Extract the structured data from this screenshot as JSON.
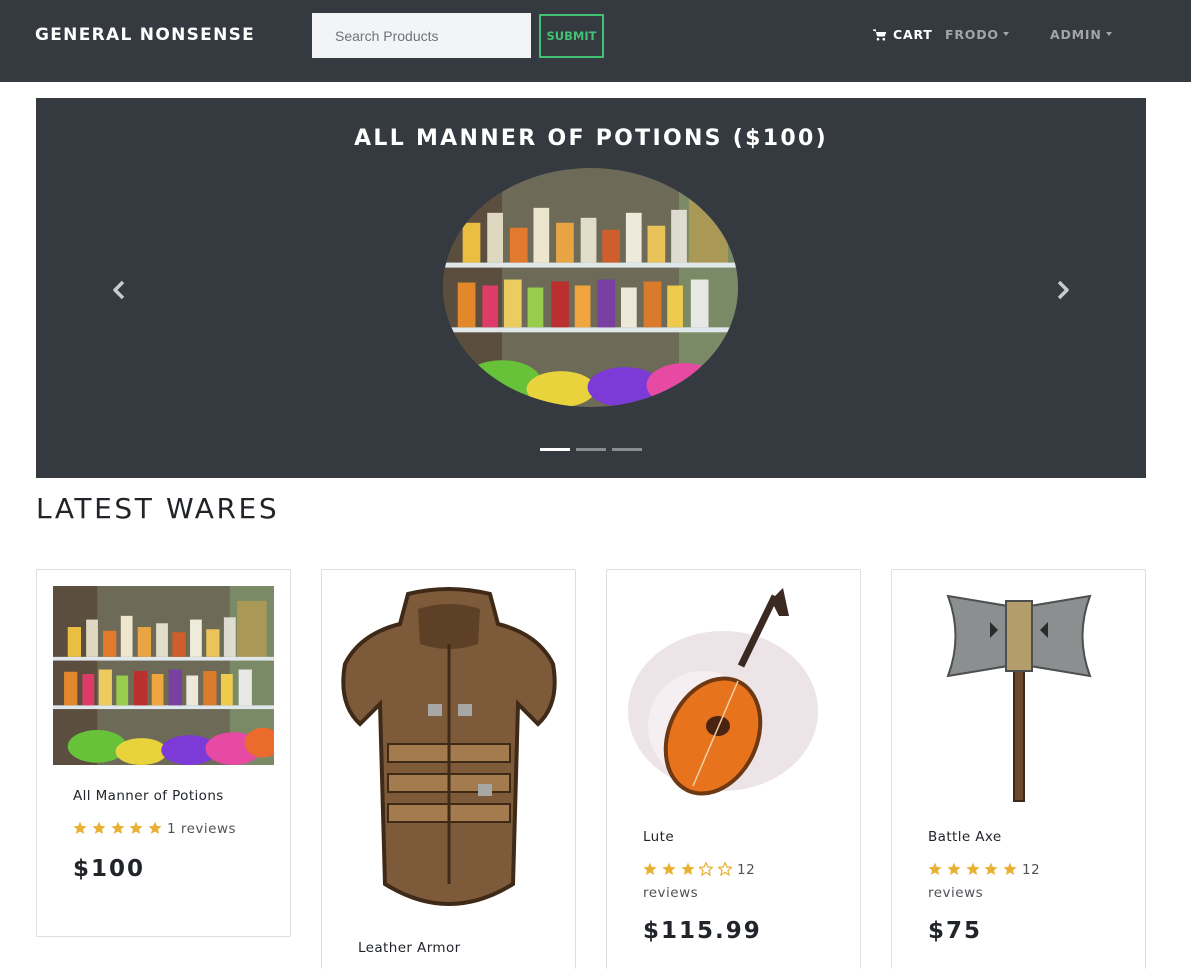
{
  "brand": "GENERAL NONSENSE",
  "search": {
    "placeholder": "Search Products",
    "submit_label": "SUBMIT"
  },
  "nav": {
    "cart_label": "CART",
    "user_label": "FRODO",
    "admin_label": "ADMIN"
  },
  "carousel": {
    "slide_title": "ALL MANNER OF POTIONS ($100)",
    "slide_image": "potions-image",
    "slide_count": 3,
    "active_slide": 1
  },
  "section_title": "LATEST WARES",
  "products": [
    {
      "name": "All Manner of Potions",
      "rating": 5,
      "reviews": "1 reviews",
      "price": "$100",
      "image": "potions-image"
    },
    {
      "name": "Leather Armor",
      "image": "leather-armor-image"
    },
    {
      "name": "Lute",
      "rating": 3,
      "reviews": "12 reviews",
      "price": "$115.99",
      "image": "lute-image"
    },
    {
      "name": "Battle Axe",
      "rating": 5,
      "reviews": "12 reviews",
      "price": "$75",
      "image": "battle-axe-image"
    }
  ],
  "colors": {
    "navbar": "#343a40",
    "accent": "#41c173",
    "star": "#e8b133"
  }
}
